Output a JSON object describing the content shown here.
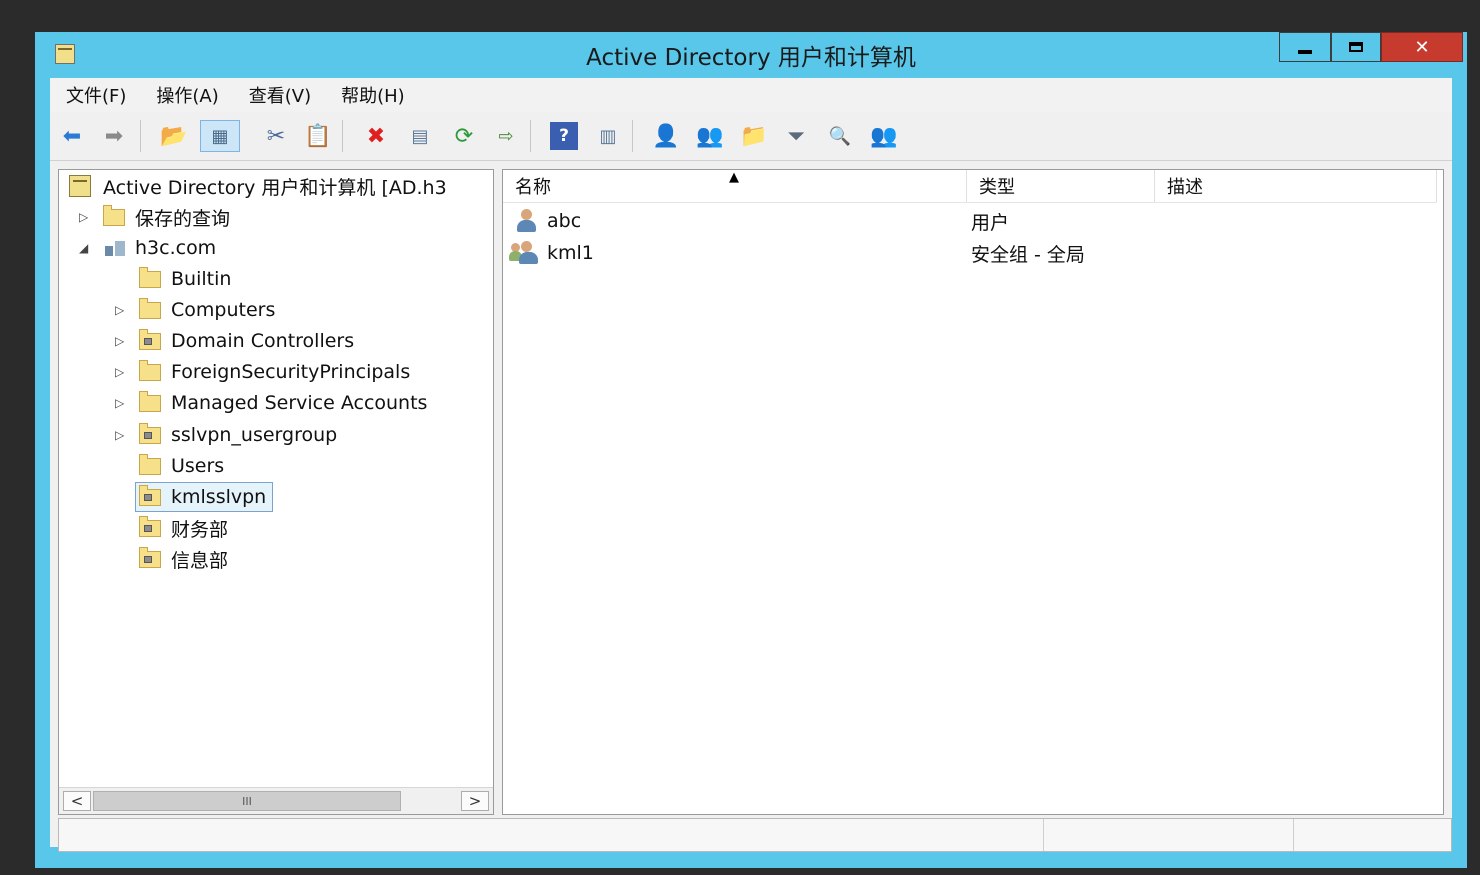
{
  "window": {
    "title": "Active Directory 用户和计算机"
  },
  "menu": [
    "文件(F)",
    "操作(A)",
    "查看(V)",
    "帮助(H)"
  ],
  "toolbar_icons": [
    "back-arrow-icon",
    "forward-arrow-icon",
    "up-folder-icon",
    "show-console-tree-icon",
    "cut-icon",
    "paste-icon",
    "delete-icon",
    "properties-icon",
    "refresh-icon",
    "export-list-icon",
    "help-icon",
    "show-action-pane-icon",
    "create-user-icon",
    "create-group-icon",
    "create-ou-icon",
    "filter-icon",
    "find-icon",
    "add-to-group-icon"
  ],
  "tree": {
    "root": "Active Directory 用户和计算机 [AD.h3",
    "saved_queries": "保存的查询",
    "domain": "h3c.com",
    "items": [
      "Builtin",
      "Computers",
      "Domain Controllers",
      "ForeignSecurityPrincipals",
      "Managed Service Accounts",
      "sslvpn_usergroup",
      "Users",
      "kmlsslvpn",
      "财务部",
      "信息部"
    ],
    "selected": "kmlsslvpn"
  },
  "scrollbar": {
    "thumb_label": "III",
    "left": "<",
    "right": ">"
  },
  "list": {
    "columns": [
      "名称",
      "类型",
      "描述"
    ],
    "rows": [
      {
        "name": "abc",
        "type": "用户",
        "desc": ""
      },
      {
        "name": "kml1",
        "type": "安全组 - 全局",
        "desc": ""
      }
    ]
  },
  "colors": {
    "frame": "#58c7ea",
    "close": "#c73b2e",
    "selection": "#e5f3fb"
  }
}
